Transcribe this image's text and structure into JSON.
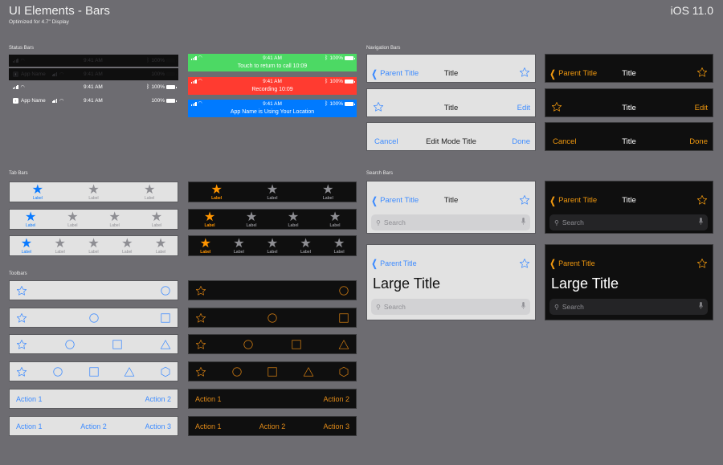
{
  "header": {
    "title": "UI Elements - Bars",
    "subtitle": "Optimized for 4.7\" Display",
    "version": "iOS 11.0"
  },
  "sections": {
    "status_bars": "Status Bars",
    "tab_bars": "Tab Bars",
    "toolbars": "Toolbars",
    "navigation_bars": "Navigation Bars",
    "search_bars": "Search Bars"
  },
  "status_bars": [
    {
      "style": "dark",
      "app_name": "",
      "time": "9:41 AM",
      "bluetooth": true,
      "battery": "100%"
    },
    {
      "style": "dark",
      "app_name": "App Name",
      "time": "9:41 AM",
      "bluetooth": false,
      "battery": "100%"
    },
    {
      "style": "white",
      "app_name": "",
      "time": "9:41 AM",
      "bluetooth": true,
      "battery": "100%"
    },
    {
      "style": "white",
      "app_name": "App Name",
      "time": "9:41 AM",
      "bluetooth": false,
      "battery": "100%"
    }
  ],
  "colored_status_bars": [
    {
      "color": "#4cd964",
      "time": "9:41 AM",
      "battery": "100%",
      "message": "Touch to return to call 10:09"
    },
    {
      "color": "#ff3b30",
      "time": "9:41 AM",
      "battery": "100%",
      "message": "Recording 10:09"
    },
    {
      "color": "#007aff",
      "time": "9:41 AM",
      "battery": "100%",
      "message": "App Name is Using Your Location"
    }
  ],
  "tab_label": "Label",
  "colors": {
    "light_accent": "#0a7aff",
    "dark_accent": "#ff9500",
    "inactive": "#8e8e93",
    "background": "#6d6c71"
  },
  "toolbars": {
    "action1": "Action 1",
    "action2": "Action 2",
    "action3": "Action 3"
  },
  "nav_bars": {
    "light": {
      "parent_title": "Parent Title",
      "title": "Title",
      "edit": "Edit",
      "cancel": "Cancel",
      "edit_mode_title": "Edit Mode Title",
      "done": "Done"
    },
    "dark": {
      "parent_title": "Parent Title",
      "title": "Title",
      "edit": "Edit",
      "cancel": "Cancel",
      "edit_mode_title": "Title",
      "done": "Done"
    }
  },
  "search_bars": {
    "parent_title": "Parent Title",
    "title": "Title",
    "large_title": "Large Title",
    "placeholder": "Search"
  }
}
